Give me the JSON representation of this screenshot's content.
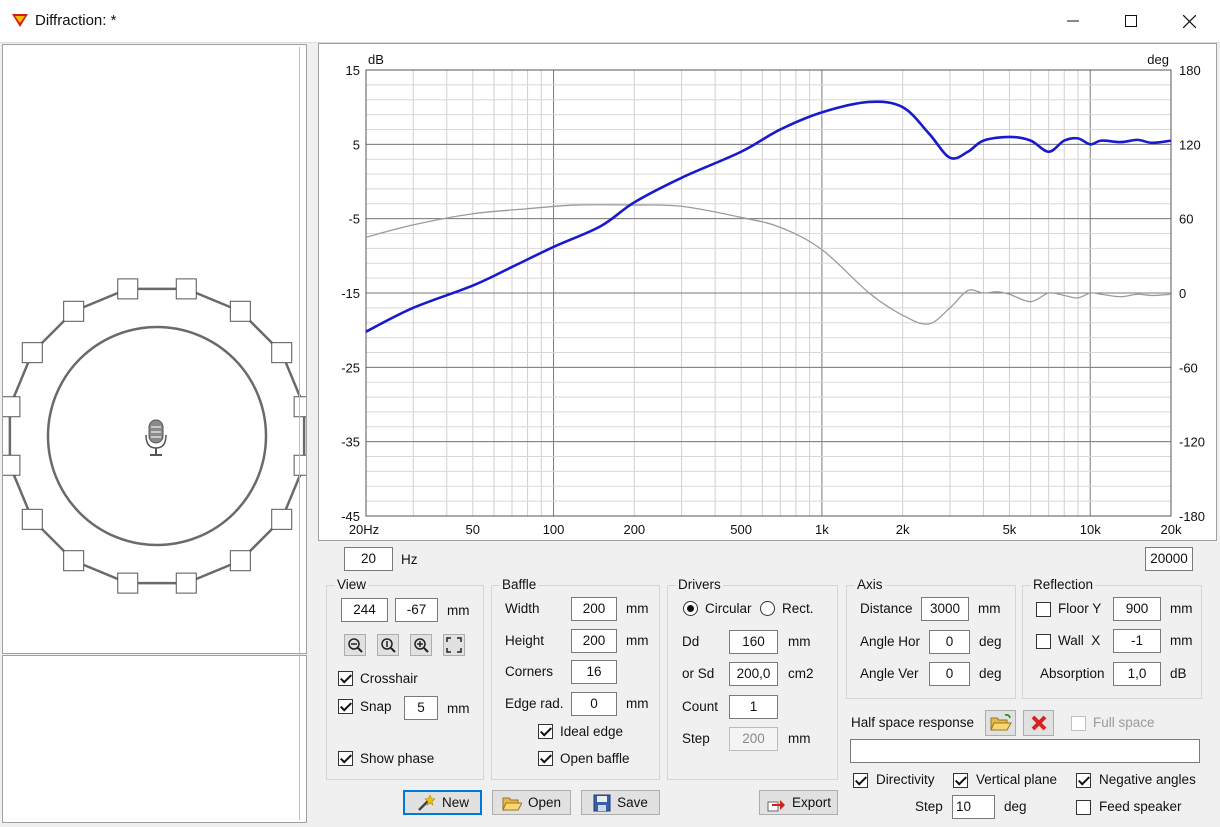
{
  "window": {
    "title": "Diffraction: *",
    "minimize_glyph": "—",
    "maximize_glyph": "☐",
    "close_glyph": "✕"
  },
  "chart_data": {
    "type": "line",
    "x_scale": "log",
    "xlim": [
      20,
      20000
    ],
    "x_tick_labels": [
      "20Hz",
      "50",
      "100",
      "200",
      "500",
      "1k",
      "2k",
      "5k",
      "10k",
      "20k"
    ],
    "x_tick_values": [
      20,
      50,
      100,
      200,
      500,
      1000,
      2000,
      5000,
      10000,
      20000
    ],
    "ylabel_left": "dB",
    "ylim_left": [
      -45,
      15
    ],
    "y_ticks_left": [
      "15",
      "5",
      "-5",
      "-15",
      "-25",
      "-35",
      "-45"
    ],
    "ylabel_right": "deg",
    "ylim_right": [
      -180,
      180
    ],
    "y_ticks_right": [
      "180",
      "120",
      "60",
      "0",
      "-60",
      "-120",
      "-180"
    ],
    "grid": true,
    "series": [
      {
        "color": "#1a1acd",
        "axis": "left",
        "points": [
          [
            20,
            -20.2
          ],
          [
            30,
            -17
          ],
          [
            50,
            -14
          ],
          [
            70,
            -11.5
          ],
          [
            100,
            -8.8
          ],
          [
            150,
            -6
          ],
          [
            200,
            -2.8
          ],
          [
            300,
            0.5
          ],
          [
            500,
            4
          ],
          [
            700,
            7
          ],
          [
            1000,
            9.3
          ],
          [
            1500,
            10.7
          ],
          [
            2000,
            10
          ],
          [
            2500,
            6.5
          ],
          [
            3000,
            3.2
          ],
          [
            3500,
            4
          ],
          [
            4000,
            5.5
          ],
          [
            5000,
            6
          ],
          [
            6000,
            5.5
          ],
          [
            7000,
            4
          ],
          [
            8000,
            5.5
          ],
          [
            9000,
            5.8
          ],
          [
            10000,
            5
          ],
          [
            11000,
            5.5
          ],
          [
            13000,
            5.3
          ],
          [
            15000,
            5.6
          ],
          [
            17000,
            5.2
          ],
          [
            20000,
            5.5
          ]
        ]
      },
      {
        "color": "#9b9b9b",
        "axis": "right",
        "points": [
          [
            20,
            45
          ],
          [
            30,
            55
          ],
          [
            50,
            64
          ],
          [
            80,
            68
          ],
          [
            120,
            71
          ],
          [
            200,
            71
          ],
          [
            300,
            70
          ],
          [
            500,
            61
          ],
          [
            700,
            53
          ],
          [
            1000,
            35
          ],
          [
            1500,
            0
          ],
          [
            2000,
            -18
          ],
          [
            2500,
            -25
          ],
          [
            3000,
            -12
          ],
          [
            3500,
            2
          ],
          [
            4000,
            0
          ],
          [
            4500,
            1
          ],
          [
            5000,
            -1
          ],
          [
            6000,
            -7
          ],
          [
            7000,
            0
          ],
          [
            8000,
            -2
          ],
          [
            9000,
            -4
          ],
          [
            10000,
            0
          ],
          [
            11000,
            -1
          ],
          [
            13000,
            -3
          ],
          [
            15000,
            -1
          ],
          [
            17000,
            -2
          ],
          [
            20000,
            -1
          ]
        ]
      }
    ]
  },
  "freq": {
    "min": "20",
    "unit": "Hz",
    "max": "20000"
  },
  "view": {
    "title": "View",
    "x": "244",
    "y": "-67",
    "unit": "mm",
    "crosshair": "Crosshair",
    "crosshair_checked": true,
    "snap": "Snap",
    "snap_checked": true,
    "snap_value": "5",
    "snap_unit": "mm",
    "show_phase": "Show phase",
    "show_phase_checked": true
  },
  "baffle": {
    "title": "Baffle",
    "width_label": "Width",
    "width": "200",
    "width_unit": "mm",
    "height_label": "Height",
    "height": "200",
    "height_unit": "mm",
    "corners_label": "Corners",
    "corners": "16",
    "edge_label": "Edge rad.",
    "edge": "0",
    "edge_unit": "mm",
    "ideal_edge": "Ideal edge",
    "open_baffle": "Open baffle"
  },
  "drivers": {
    "title": "Drivers",
    "circular": "Circular",
    "rect": "Rect.",
    "dd_label": "Dd",
    "dd": "160",
    "dd_unit": "mm",
    "sd_label": "or Sd",
    "sd": "200,0",
    "sd_unit": "cm2",
    "count_label": "Count",
    "count": "1",
    "step_label": "Step",
    "step": "200",
    "step_unit": "mm"
  },
  "axis": {
    "title": "Axis",
    "distance_label": "Distance",
    "distance": "3000",
    "distance_unit": "mm",
    "hor_label": "Angle Hor",
    "hor": "0",
    "hor_unit": "deg",
    "ver_label": "Angle Ver",
    "ver": "0",
    "ver_unit": "deg"
  },
  "reflection": {
    "title": "Reflection",
    "floor_label": "Floor Y",
    "floor": "900",
    "floor_unit": "mm",
    "wall_label": "Wall  X",
    "wall": "-1",
    "wall_unit": "mm",
    "absorption_label": "Absorption",
    "absorption": "1,0",
    "absorption_unit": "dB"
  },
  "half_space": {
    "label": "Half space response",
    "full_space": "Full space",
    "path": ""
  },
  "directivity": {
    "directivity": "Directivity",
    "vertical_plane": "Vertical plane",
    "negative_angles": "Negative angles",
    "step_label": "Step",
    "step": "10",
    "step_unit": "deg",
    "feed_speaker": "Feed speaker"
  },
  "buttons": {
    "new": "New",
    "open": "Open",
    "save": "Save",
    "export": "Export"
  }
}
